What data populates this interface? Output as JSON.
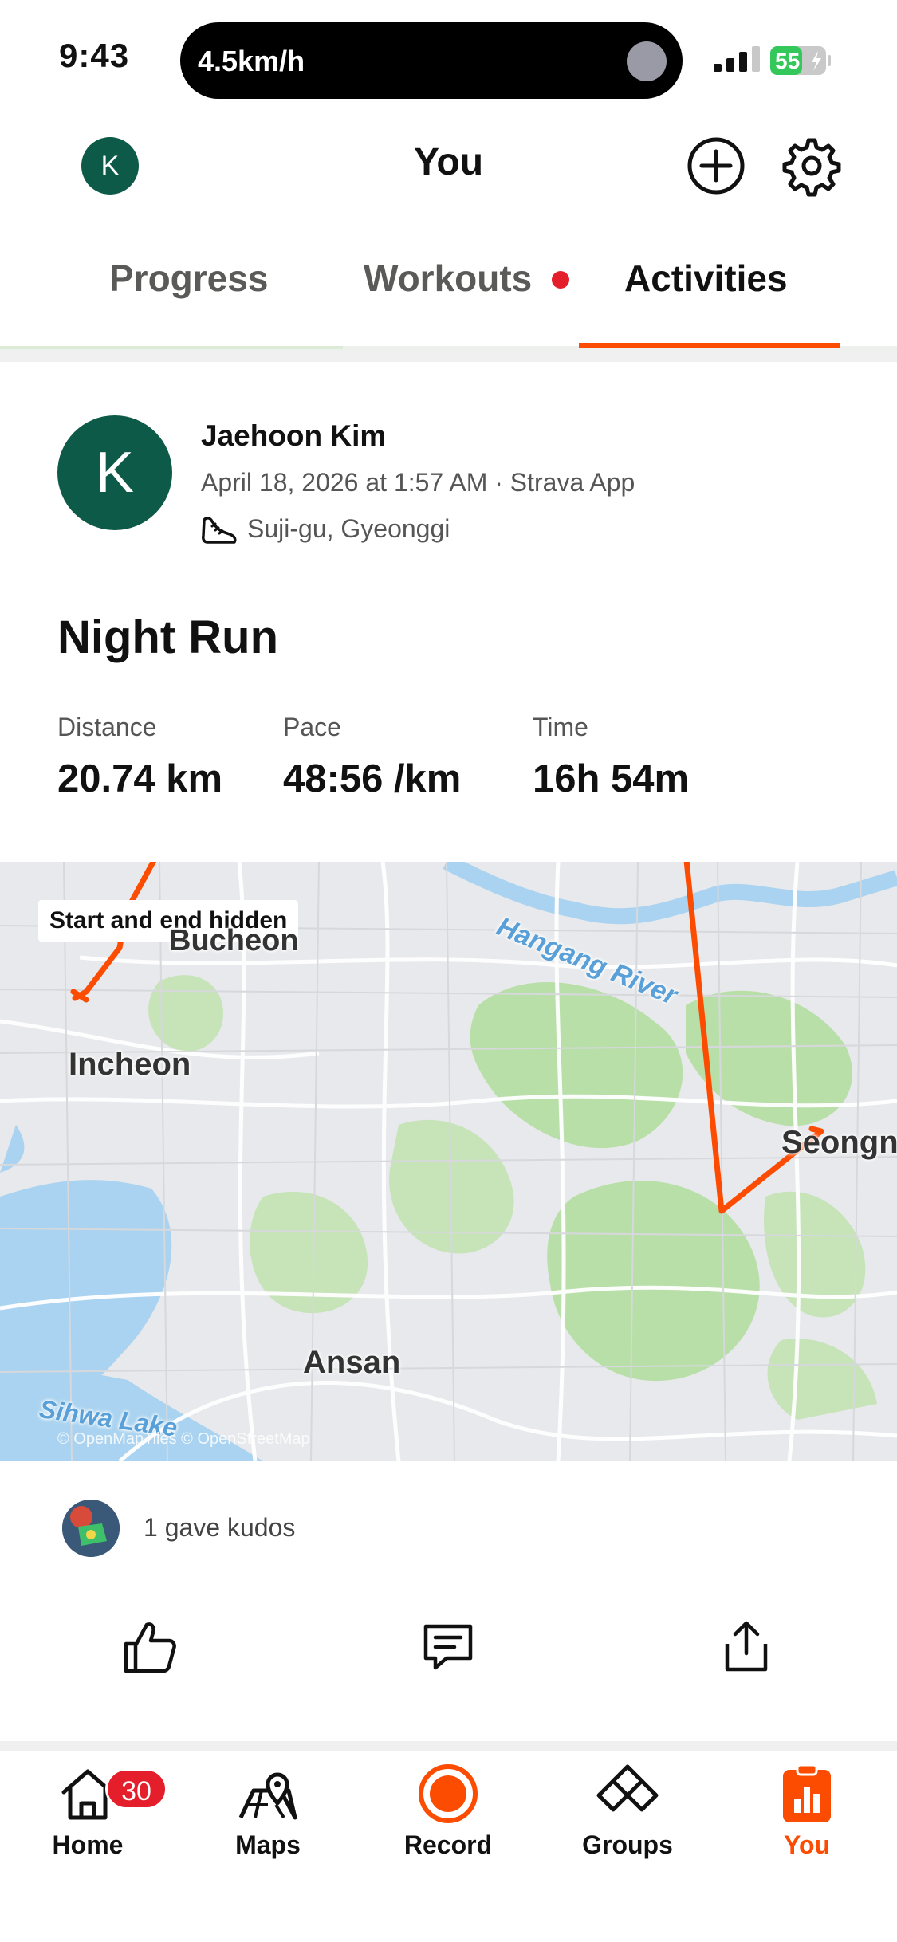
{
  "status_bar": {
    "time": "9:43",
    "live_activity": "4.5km/h",
    "battery": "55"
  },
  "header": {
    "avatar_initial": "K",
    "title": "You",
    "add_icon": "plus-circle-icon",
    "settings_icon": "gear-icon"
  },
  "tabs": [
    {
      "label": "Progress",
      "active": false
    },
    {
      "label": "Workouts",
      "active": false,
      "has_notification_dot": true
    },
    {
      "label": "Activities",
      "active": true
    }
  ],
  "activity": {
    "athlete": {
      "initial": "K",
      "name": "Jaehoon Kim"
    },
    "meta": "April 18, 2026 at 1:57 AM · Strava App",
    "location": "Suji-gu, Gyeonggi",
    "sport_icon": "running-shoe-icon",
    "title": "Night Run",
    "stats": {
      "distance": {
        "label": "Distance",
        "value": "20.74 km"
      },
      "pace": {
        "label": "Pace",
        "value": "48:56 /km"
      },
      "time": {
        "label": "Time",
        "value": "16h 54m"
      }
    },
    "map": {
      "badge": "Start and end hidden",
      "labels": {
        "bucheon": "Bucheon",
        "incheon": "Incheon",
        "ansan": "Ansan",
        "seongnam": "Seongn",
        "river": "Hangang River",
        "lake": "Sihwa Lake"
      },
      "attribution": "© OpenMapTiles © OpenStreetMap",
      "route_color": "#fc4c02"
    },
    "kudos": {
      "text": "1 gave kudos"
    },
    "actions": [
      {
        "name": "kudos",
        "icon": "thumbs-up-icon"
      },
      {
        "name": "comment",
        "icon": "comment-icon"
      },
      {
        "name": "share",
        "icon": "share-icon"
      }
    ]
  },
  "bottom_nav": [
    {
      "label": "Home",
      "icon": "home-icon",
      "badge": "30",
      "active": false
    },
    {
      "label": "Maps",
      "icon": "map-icon",
      "active": false
    },
    {
      "label": "Record",
      "icon": "record-icon",
      "active": false
    },
    {
      "label": "Groups",
      "icon": "groups-icon",
      "active": false
    },
    {
      "label": "You",
      "icon": "you-icon",
      "active": true
    }
  ],
  "colors": {
    "accent": "#fc4c02",
    "avatar_bg": "#0c5a47",
    "notification_red": "#e41e2a"
  }
}
